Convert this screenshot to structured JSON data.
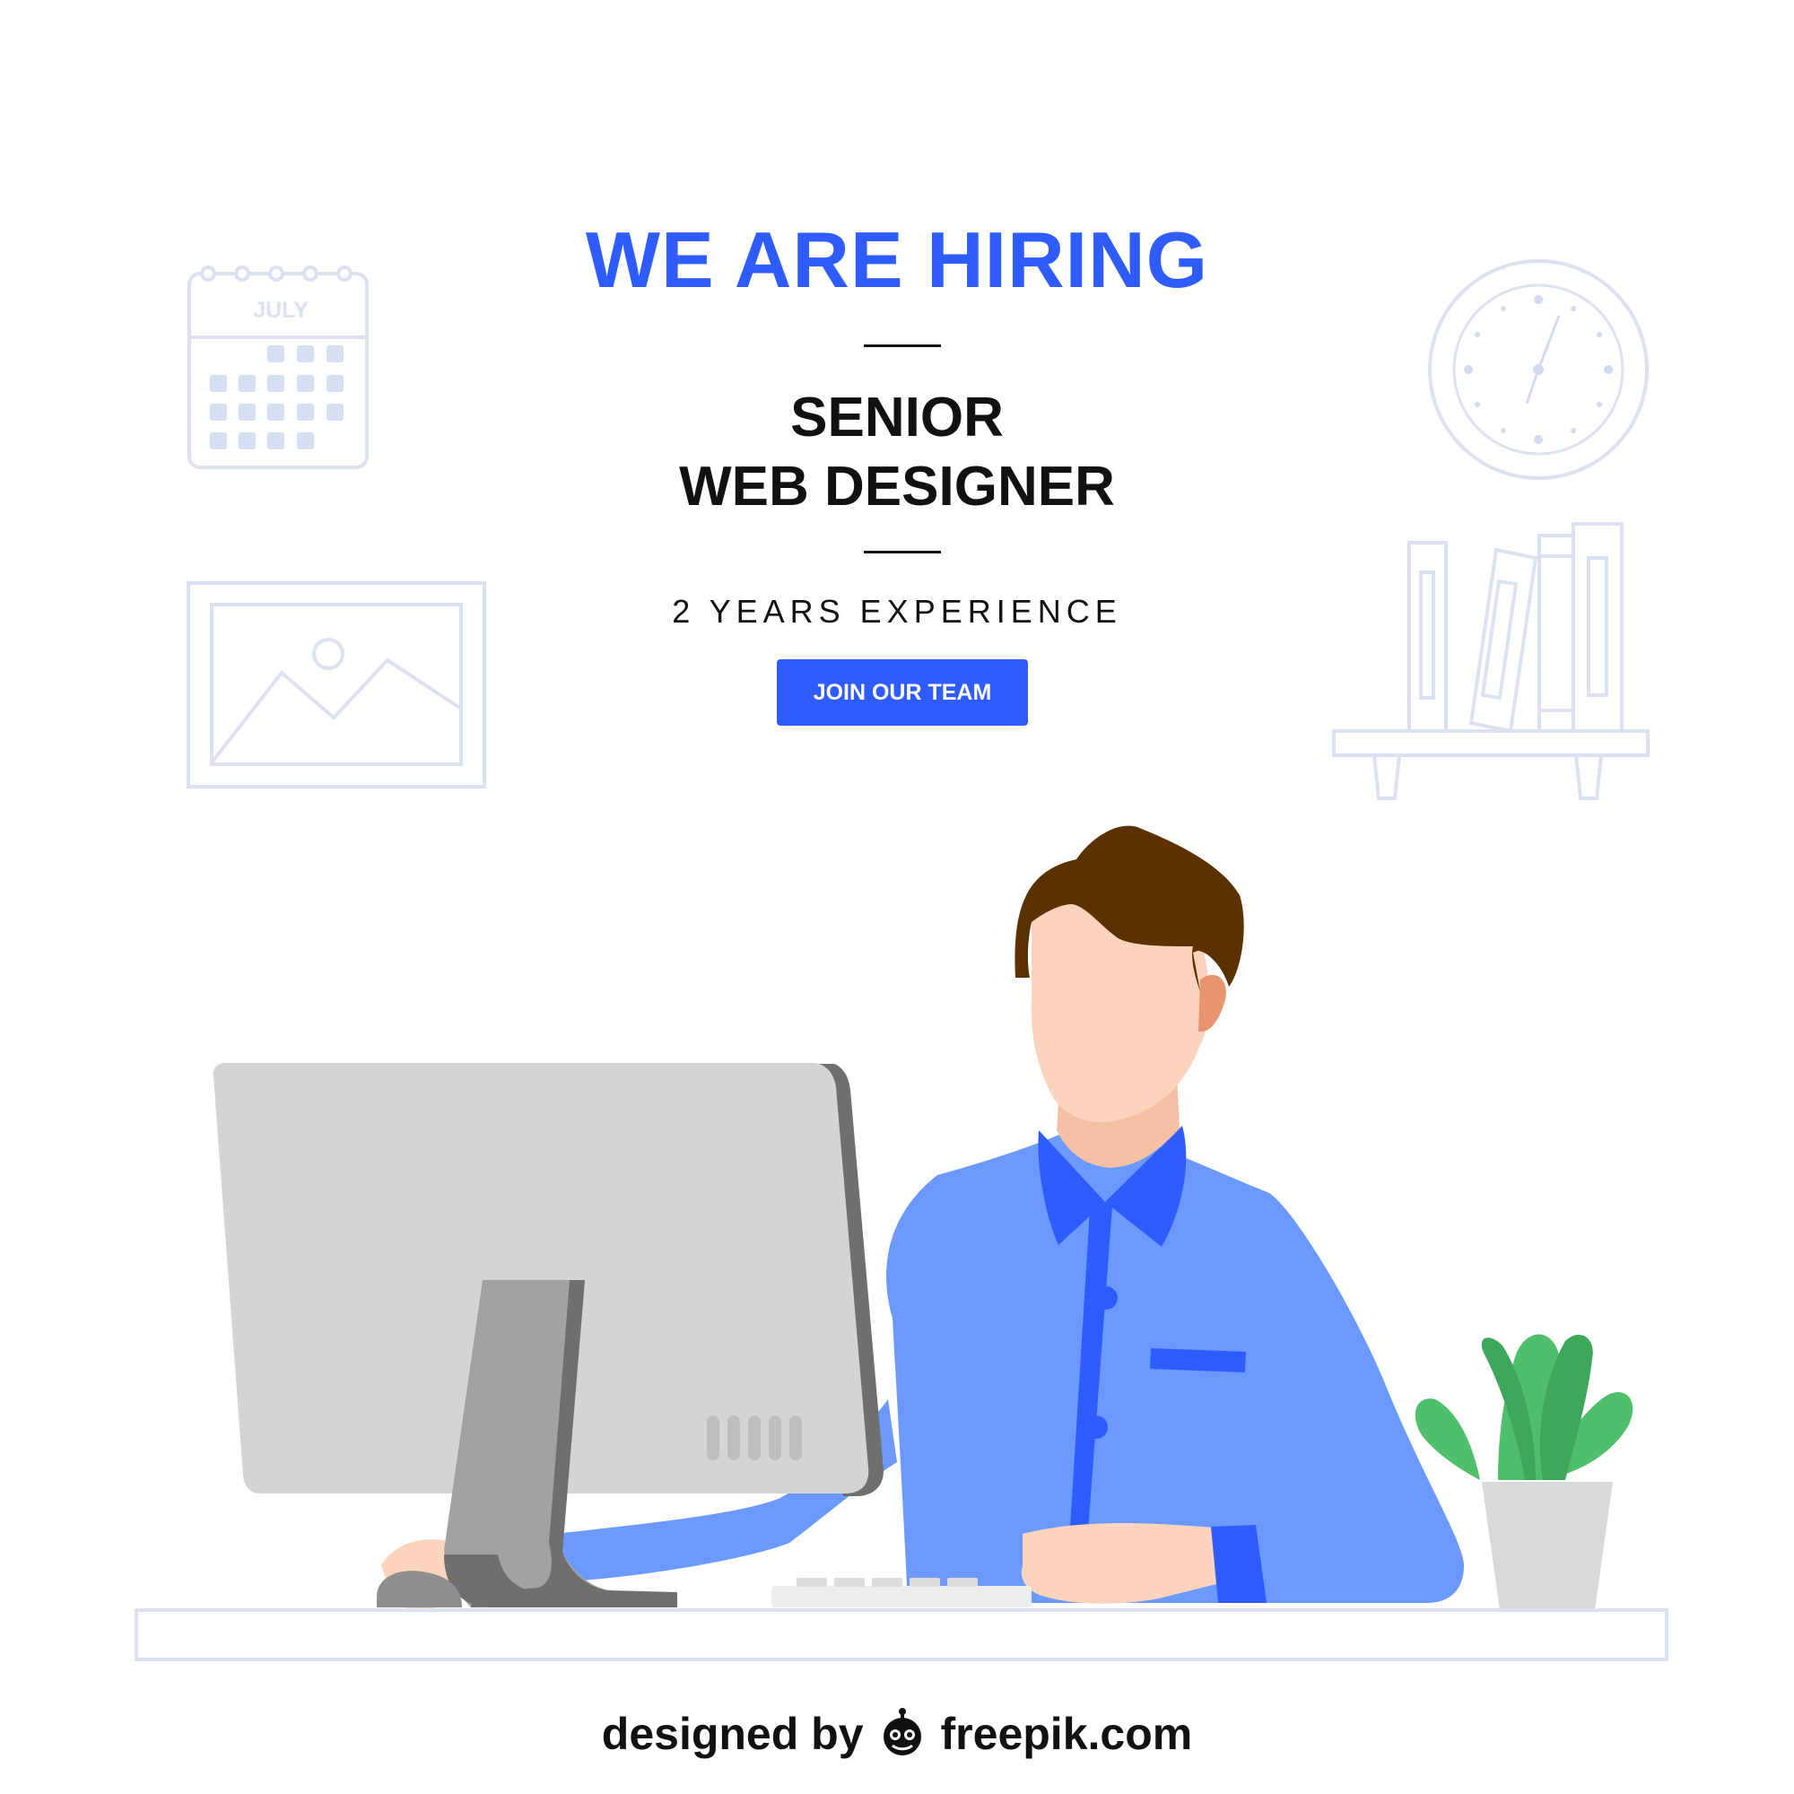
{
  "poster": {
    "headline": "WE ARE HIRING",
    "job_title_line_1": "SENIOR",
    "job_title_line_2": "WEB DESIGNER",
    "experience": "2 YEARS EXPERIENCE",
    "cta_label": "JOIN OUR TEAM"
  },
  "decor": {
    "calendar_month": "JULY"
  },
  "credit": {
    "prefix": "designed by",
    "brand": "freepik.com",
    "logo_icon": "freepik-logo-icon"
  },
  "colors": {
    "accent_blue": "#2f5cff",
    "shirt_blue": "#6b99ff",
    "outline_lavender": "#dde2f2",
    "calendar_cell": "#d9dff3",
    "text_dark": "#111111",
    "hair_brown": "#5c3100",
    "skin": "#fcd4bd",
    "plant_green": "#4fbf6b",
    "monitor_gray": "#d4d4d6",
    "stand_gray": "#a2a2a2"
  },
  "icons": [
    "calendar-icon",
    "clock-icon",
    "picture-frame-icon",
    "bookshelf-icon",
    "plant-icon",
    "computer-monitor-icon",
    "keyboard-icon",
    "mouse-icon",
    "person-icon"
  ]
}
